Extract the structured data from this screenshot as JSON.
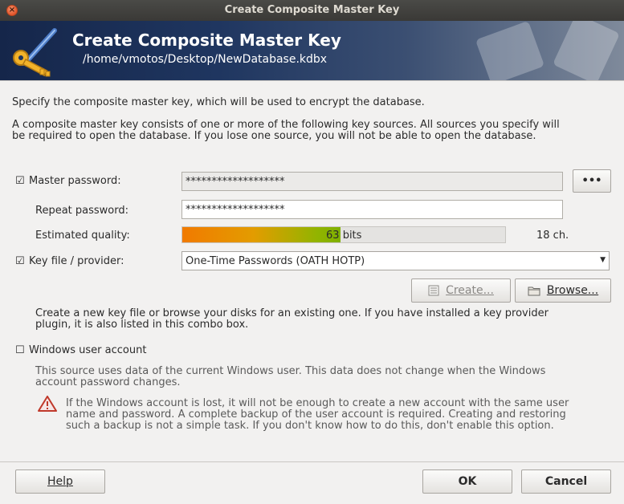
{
  "window": {
    "title": "Create Composite Master Key",
    "close_glyph": "×"
  },
  "banner": {
    "title": "Create Composite Master Key",
    "subtitle": "/home/vmotos/Desktop/NewDatabase.kdbx"
  },
  "intro": {
    "line1": "Specify the composite master key, which will be used to encrypt the database.",
    "line2": "A composite master key consists of one or more of the following key sources. All sources you specify will",
    "line3": "be required to open the database.  If you lose one source, you will not be able to open the database."
  },
  "master_password": {
    "checked": true,
    "check_glyph": "☑",
    "label": "Master password:",
    "value": "*******************",
    "reveal_label": "•••"
  },
  "repeat_password": {
    "label": "Repeat password:",
    "value": "*******************"
  },
  "quality": {
    "label": "Estimated quality:",
    "bits": "63",
    "bits_unit": "bits",
    "fraction": 0.49,
    "length": "18 ch."
  },
  "key_file": {
    "checked": true,
    "check_glyph": "☑",
    "label": "Key file / provider:",
    "selected": "One-Time Passwords (OATH HOTP)",
    "create_label": "Create...",
    "browse_label": "Browse...",
    "help_line1": "Create a new key file or browse your disks for an existing one. If you have installed a key provider",
    "help_line2": "plugin, it is also listed in this combo box."
  },
  "windows_account": {
    "checked": false,
    "check_glyph": "☐",
    "label": "Windows user account",
    "desc_line1": "This source uses data of the current Windows user. This data does not change when the Windows",
    "desc_line2": "account password changes.",
    "warn_line1": "If the Windows account is lost, it will not be enough to create a new account with the same user",
    "warn_line2": "name and password. A complete backup of the user account is required. Creating and restoring",
    "warn_line3": "such a backup is not a simple task. If you don't know how to do this, don't enable this option."
  },
  "footer": {
    "help_label": "Help",
    "ok_label": "OK",
    "cancel_label": "Cancel"
  },
  "colors": {
    "banner_dark": "#15264a",
    "quality_orange": "#f17a00",
    "quality_green": "#7fb000",
    "close_button": "#e2562c"
  }
}
